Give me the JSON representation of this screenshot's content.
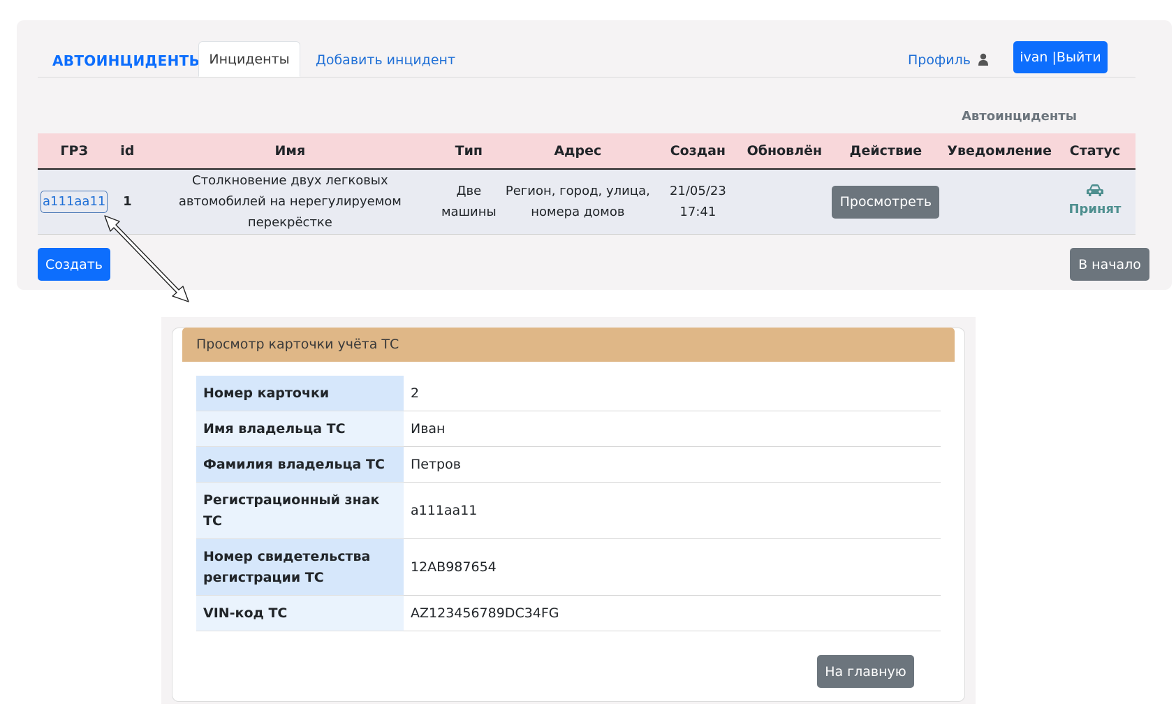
{
  "nav": {
    "brand": "АВТОИНЦИДЕНТЫ",
    "tab_incidents": "Инциденты",
    "tab_add": "Добавить инцидент",
    "profile": "Профиль",
    "logout": "ivan |Выйти"
  },
  "section_title": "Автоинциденты",
  "incidents": {
    "headers": [
      "ГРЗ",
      "id",
      "Имя",
      "Тип",
      "Адрес",
      "Создан",
      "Обновлён",
      "Действие",
      "Уведомление",
      "Статус"
    ],
    "rows": [
      {
        "plate": "а111аа11",
        "id": "1",
        "name": "Столкновение двух легковых автомобилей на нерегулируемом перекрёстке",
        "type": "Две машины",
        "address": "Регион, город, улица, номера домов",
        "created": "21/05/23 17:41",
        "updated": "",
        "action": "Просмотреть",
        "notification": "",
        "status": "Принят"
      }
    ]
  },
  "buttons": {
    "create": "Создать",
    "to_start": "В начало"
  },
  "card": {
    "title": "Просмотр карточки учёта ТС",
    "rows": [
      {
        "label": "Номер карточки",
        "value": "2"
      },
      {
        "label": "Имя владельца ТС",
        "value": "Иван"
      },
      {
        "label": "Фамилия владельца ТС",
        "value": "Петров"
      },
      {
        "label": "Регистрационный знак ТС",
        "value": "а111аа11"
      },
      {
        "label": "Номер свидетельства регистрации ТС",
        "value": "12АВ987654"
      },
      {
        "label": "VIN-код ТС",
        "value": "AZ123456789DC34FG"
      }
    ],
    "home_button": "На главную"
  },
  "colors": {
    "primary": "#0d6efd",
    "secondary": "#6c757d",
    "table_header": "#f8d7da",
    "card_header": "#dfb787",
    "status_teal": "#4e8f8f"
  },
  "icons": {
    "profile": "user-icon",
    "status": "car-icon"
  }
}
